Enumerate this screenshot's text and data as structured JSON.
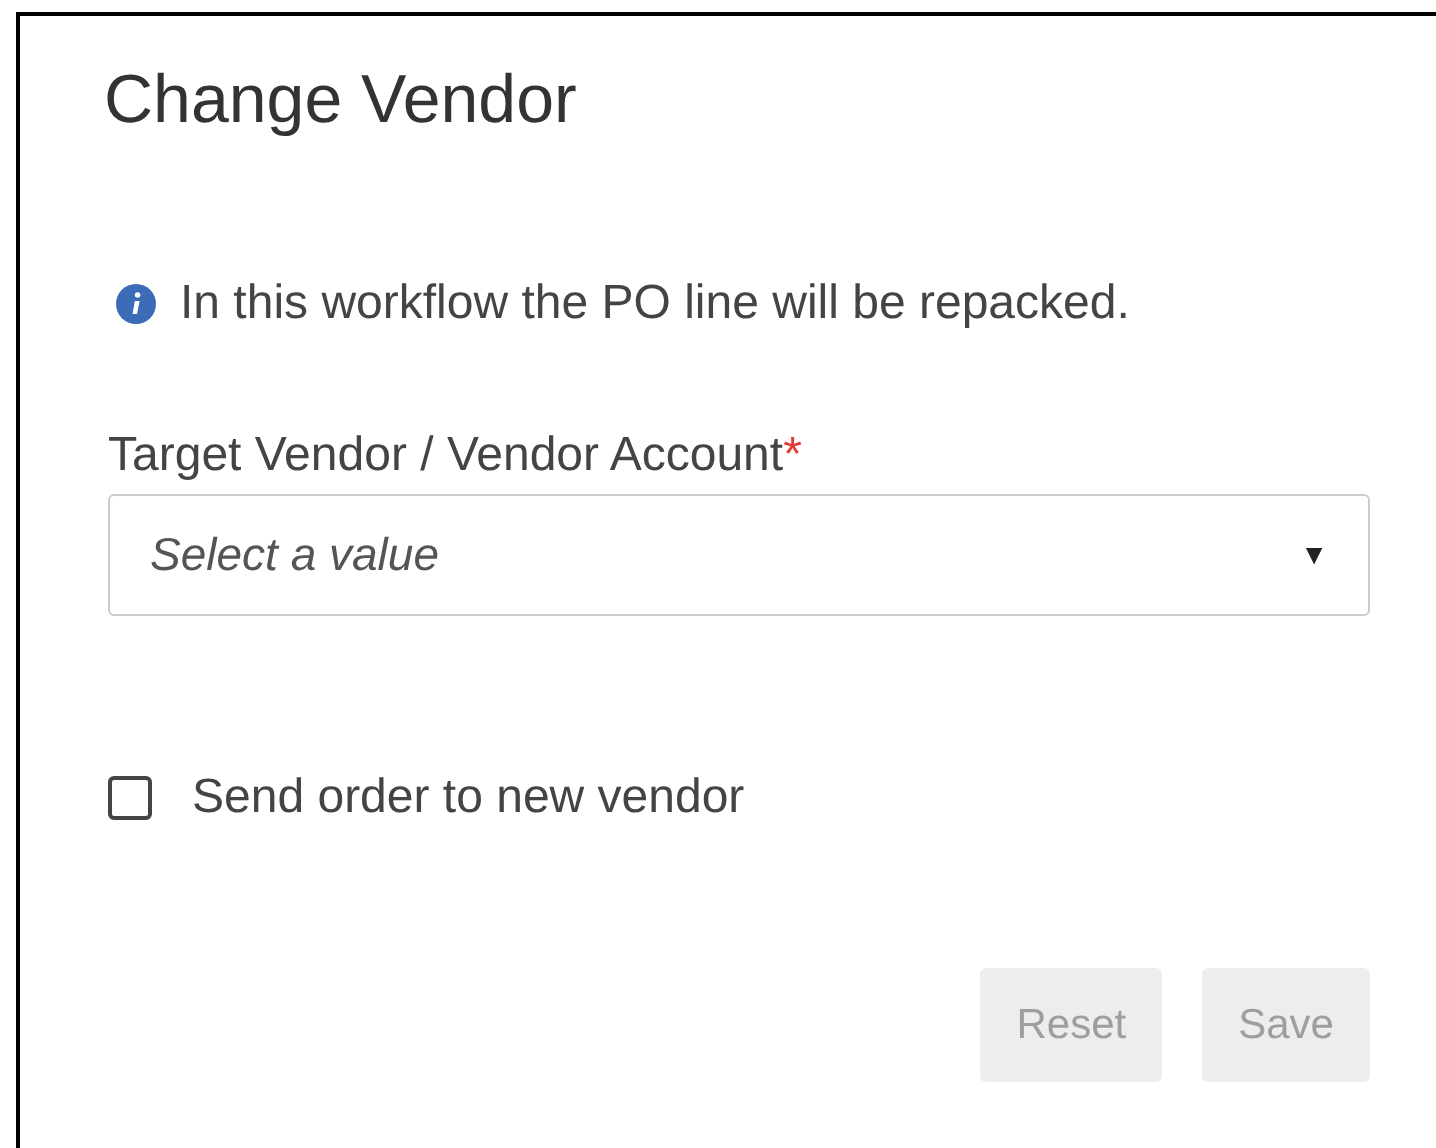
{
  "dialog": {
    "title": "Change Vendor"
  },
  "info": {
    "text": "In this workflow the PO line will be repacked."
  },
  "field": {
    "label": "Target Vendor / Vendor Account",
    "required_mark": "*",
    "placeholder": "Select a value",
    "caret": "▼"
  },
  "checkbox": {
    "label": "Send order to new vendor",
    "checked": false
  },
  "buttons": [
    {
      "label": "Reset",
      "disabled": true
    },
    {
      "label": "Save",
      "disabled": true
    }
  ]
}
